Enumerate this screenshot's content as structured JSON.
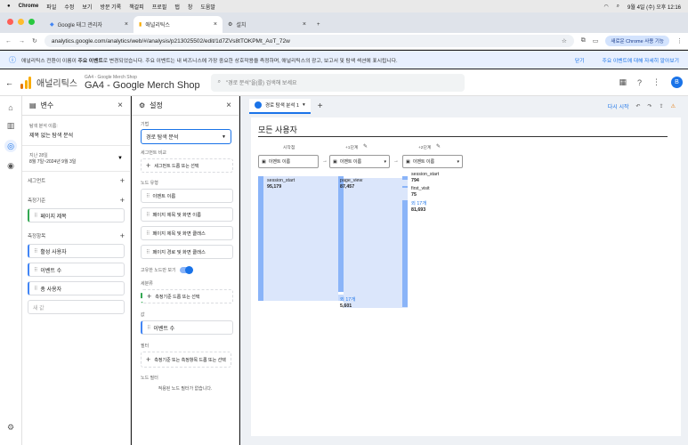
{
  "menubar": {
    "items": [
      "Chrome",
      "파일",
      "수정",
      "보기",
      "방문 기록",
      "책갈피",
      "프로필",
      "탭",
      "창",
      "도움말"
    ],
    "clock": "9월 4일 (수) 오후 12:16"
  },
  "browser": {
    "tabs": [
      "Google 태그 관리자",
      "애널리틱스",
      "설치"
    ],
    "url": "analytics.google.com/analytics/web/#/analysis/p213025502/edit/1d7ZVs8tTOKPMt_AoT_72w",
    "chrome_btn": "새로운 Chrome 사용 기능"
  },
  "banner": {
    "text_a": "애널리틱스 전환이 이름이 ",
    "text_bold": "주요 이벤트",
    "text_b": "로 변경되었습니다. 주요 이벤트는 내 비즈니스에 가장 중요한 상호작용을 측정하며, 애널리틱스의 광고, 보고서 및 탐색 섹션에 표시됩니다.",
    "close": "닫기",
    "learn": "주요 이벤트에 대해 자세히 알아보기"
  },
  "header": {
    "product": "애널리틱스",
    "account_path": "GA4 - Google Merch Shop",
    "account_name": "GA4 - Google Merch Shop",
    "search_placeholder": "\"경로 분석\"을(를) 검색해 보세요",
    "avatar": "B"
  },
  "variables": {
    "title": "변수",
    "exploration_label": "탐색 분석 이름:",
    "exploration_name": "제목 없는 탐색 분석",
    "date_label": "지난 28일",
    "date_range": "8월 7일~2024년 9월 3일",
    "segments": "세그먼트",
    "dimensions": "측정기준",
    "dimension_items": [
      "페이지 제목"
    ],
    "metrics": "측정항목",
    "metric_items": [
      "활성 사용자",
      "이벤트 수",
      "총 사용자"
    ],
    "metric_placeholder": "새 값"
  },
  "settings": {
    "title": "설정",
    "technique_label": "기법",
    "technique": "경로 탐색 분석",
    "segment_compare": "세그먼트 비교",
    "segment_add": "세그먼트 드롭 또는 선택",
    "node_type": "노드 유형",
    "node_items": [
      "이벤트 이름",
      "페이지 제목 및 화면 이름",
      "페이지 제목 및 화면 클래스",
      "페이지 경로 및 화면 클래스"
    ],
    "unique_label": "고유한 노드만 보기",
    "breakdown": "세분류",
    "breakdown_add": "측정기준 드롭 또는 선택",
    "values": "값",
    "value_item": "이벤트 수",
    "filters": "필터",
    "filter_add": "측정기준 또는 측정항목 드롭 또는 선택",
    "node_filter": "노드 필터",
    "node_filter_empty": "적용된 노드 필터가 없습니다."
  },
  "canvas": {
    "tab": "경로 탐색 분석 1",
    "restart": "다시 시작",
    "chart_title": "모든 사용자",
    "steps": [
      "시작점",
      "+1단계",
      "+2단계"
    ],
    "dropdown": "이벤트 이름"
  },
  "chart_data": {
    "type": "sankey",
    "steps": [
      {
        "name": "시작점",
        "nodes": [
          {
            "label": "session_start",
            "value": "95,179"
          }
        ]
      },
      {
        "name": "+1단계",
        "nodes": [
          {
            "label": "page_view",
            "value": "87,457"
          },
          {
            "label": "외 17개",
            "value": "5,601"
          }
        ]
      },
      {
        "name": "+2단계",
        "nodes": [
          {
            "label": "session_start",
            "value": "794"
          },
          {
            "label": "first_visit",
            "value": "75"
          },
          {
            "label": "외 17개",
            "value": "81,693"
          }
        ]
      }
    ]
  },
  "colors": {
    "accent": "#1a73e8",
    "bar": "#8ab4f8"
  }
}
